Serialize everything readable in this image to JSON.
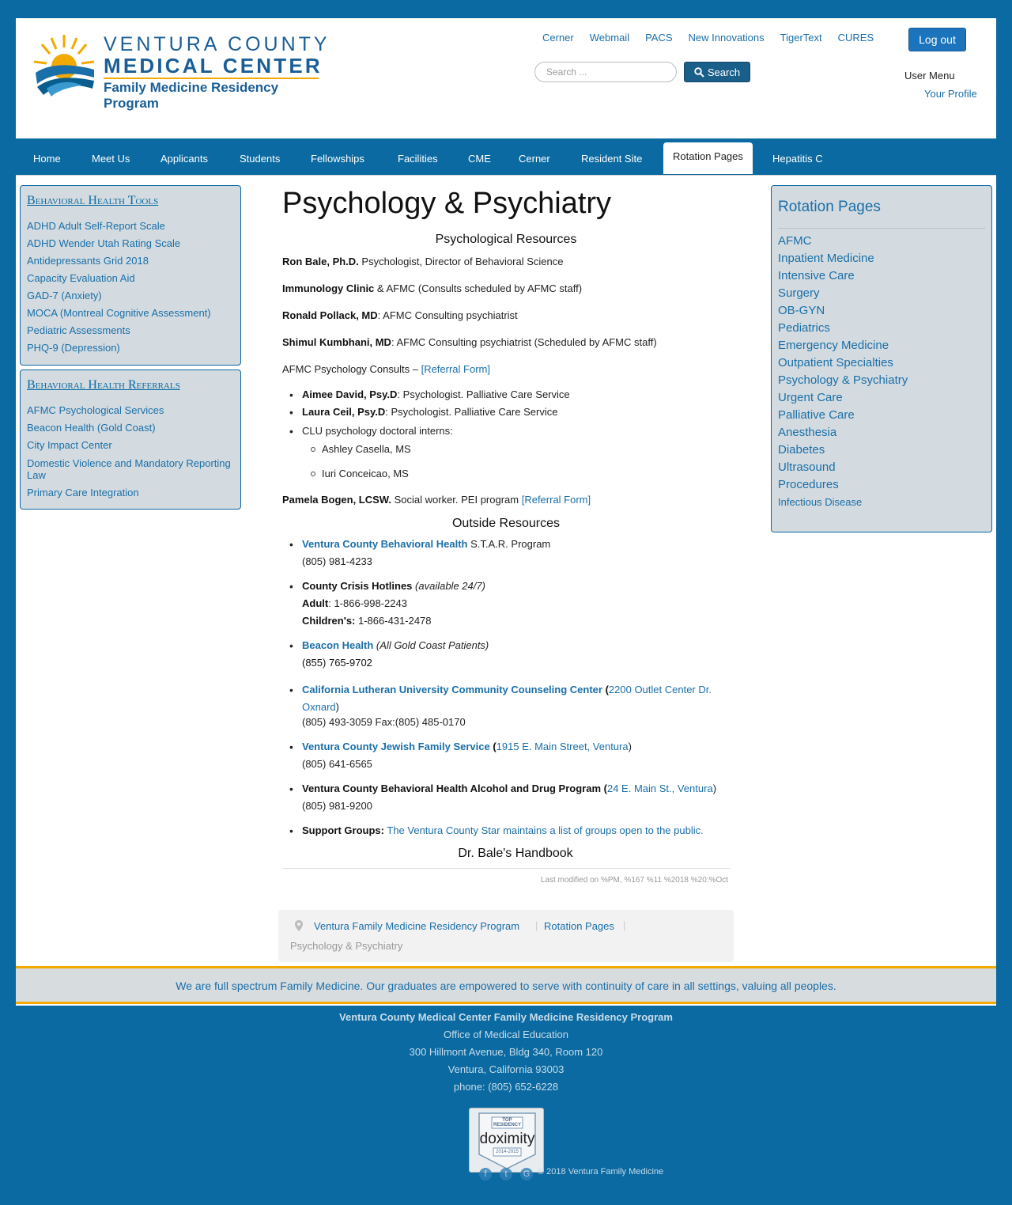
{
  "header": {
    "logo": {
      "line1": "VENTURA COUNTY",
      "line2": "MEDICAL CENTER",
      "line3": "Family Medicine Residency Program"
    },
    "top_links": [
      "Cerner",
      "Webmail",
      "PACS",
      "New Innovations",
      "TigerText",
      "CURES"
    ],
    "logout_label": "Log out",
    "search_placeholder": "Search ...",
    "search_button": "Search",
    "user_menu": "User Menu",
    "your_profile": "Your Profile"
  },
  "nav": [
    "Home",
    "Meet Us",
    "Applicants",
    "Students",
    "Fellowships",
    "Facilities",
    "CME",
    "Cerner",
    "Resident Site",
    "Rotation Pages",
    "Hepatitis C"
  ],
  "left_sidebar": {
    "tools_title": "Behavioral Health Tools",
    "tools": [
      "ADHD Adult Self-Report Scale",
      "ADHD Wender Utah Rating Scale",
      "Antidepressants Grid 2018",
      "Capacity Evaluation Aid",
      "GAD-7 (Anxiety)",
      "MOCA (Montreal Cognitive Assessment)",
      "Pediatric Assessments",
      "PHQ-9 (Depression)"
    ],
    "referrals_title": "Behavioral Health Referrals",
    "referrals": [
      "AFMC Psychological Services",
      "Beacon Health (Gold Coast)",
      "City Impact Center",
      "Domestic Violence and Mandatory Reporting Law",
      "Primary Care Integration"
    ]
  },
  "main": {
    "title": "Psychology & Psychiatry",
    "psych_heading": "Psychological Resources",
    "ron_name": "Ron Bale, Ph.D.",
    "ron_desc": " Psychologist, Director of Behavioral Science",
    "imm_name": "Immunology Clinic",
    "imm_desc": " & AFMC (Consults scheduled by AFMC staff)",
    "pollack_name": "Ronald Pollack, MD",
    "pollack_desc": ": AFMC Consulting psychiatrist",
    "kumbhani_name": "Shimul Kumbhani, MD",
    "kumbhani_desc": ": AFMC Consulting psychiatrist (Scheduled by AFMC staff)",
    "afmc_consults": "AFMC Psychology Consults – ",
    "referral_form": "[Referral Form]",
    "david_name": "Aimee David, Psy.D",
    "david_desc": ": Psychologist. Palliative Care Service",
    "ceil_name": "Laura Ceil, Psy.D",
    "ceil_desc": ": Psychologist. Palliative Care Service",
    "clu_interns": "CLU psychology doctoral interns:",
    "intern1": "Ashley Casella, MS",
    "intern2": "Iuri Conceicao, MS",
    "bogen_name": "Pamela Bogen, LCSW.",
    "bogen_desc": " Social worker. PEI program ",
    "outside_heading": "Outside Resources",
    "vcbh_link": "Ventura County Behavioral Health",
    "vcbh_desc": " S.T.A.R. Program",
    "vcbh_phone": "(805) 981-4233",
    "crisis_name": "County Crisis Hotlines",
    "crisis_avail": " (available 24/7)",
    "adult_label": "Adult",
    "adult_phone": ": 1-866-998-2243",
    "children_label": "Children's:",
    "children_phone": " 1-866-431-2478",
    "beacon_link": "Beacon Health",
    "beacon_desc": " (All Gold Coast Patients)",
    "beacon_phone": "(855) 765-9702",
    "clu_link": "California Lutheran University Community Counseling Center",
    "clu_paren_open": " (",
    "clu_address1": "2200 Outlet Center Dr.",
    "clu_address2": "Oxnard",
    "clu_paren_close": ")",
    "clu_phone": "(805) 493-3059 Fax:(805) 485-0170",
    "jfs_link": "Ventura County Jewish Family Service",
    "jfs_address": "1915 E. Main Street, Ventura",
    "jfs_phone": "(805) 641-6565",
    "adp_name": "Ventura County Behavioral Health Alcohol and Drug Program",
    "adp_address": "24 E. Main St., Ventura",
    "adp_phone": "(805) 981-9200",
    "support_name": "Support Groups:",
    "support_link": " The Ventura County Star maintains a list of groups open to the public.",
    "handbook": "Dr. Bale's Handbook",
    "last_modified": "Last modified on %PM, %167 %11 %2018 %20:%Oct"
  },
  "right_sidebar": {
    "title": "Rotation Pages",
    "items": [
      "AFMC",
      "Inpatient Medicine",
      "Intensive Care",
      "Surgery",
      "OB-GYN",
      "Pediatrics",
      "Emergency Medicine",
      "Outpatient Specialties",
      "Psychology & Psychiatry",
      "Urgent Care",
      "Palliative Care",
      "Anesthesia",
      "Diabetes",
      "Ultrasound",
      "Procedures",
      "Infectious Disease"
    ]
  },
  "breadcrumb": [
    "Ventura Family Medicine Residency Program",
    "Rotation Pages",
    "Psychology & Psychiatry"
  ],
  "footer": {
    "mission": "We are full spectrum Family Medicine. Our graduates are empowered to serve with continuity of care in all settings, valuing all peoples.",
    "org": "Ventura County Medical Center Family Medicine Residency Program",
    "office": "Office of Medical Education",
    "address": "300 Hillmont Avenue, Bldg 340, Room 120",
    "city": "Ventura, California 93003",
    "phone": "phone: (805) 652-6228",
    "badge_top": "TOP RESIDENCY",
    "badge_brand": "doximity",
    "badge_years": "2014-2015",
    "copyright": "© 2018 Ventura Family Medicine"
  },
  "colors": {
    "brand_blue": "#0a6aa1",
    "link": "#1a6fa8",
    "accent_gold": "#f2a900",
    "sidebar_bg": "#d3dbe0"
  }
}
